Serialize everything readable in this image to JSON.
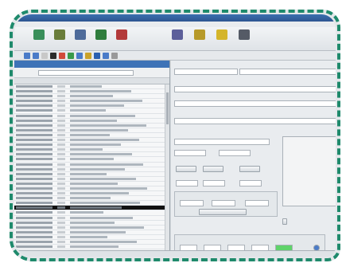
{
  "app": {
    "title": ""
  },
  "menu": [],
  "toolbar": [
    {
      "icon": "database-icon",
      "color": "#3a8f5a",
      "label": ""
    },
    {
      "icon": "book-icon",
      "color": "#6a7d3a",
      "label": ""
    },
    {
      "icon": "bird-icon",
      "color": "#4e6b9a",
      "label": ""
    },
    {
      "icon": "leaf-icon",
      "color": "#2f7d3d",
      "label": ""
    },
    {
      "icon": "heart-icon",
      "color": "#b33a3a",
      "label": ""
    },
    {
      "icon": "building-icon",
      "color": "#5c5f9a",
      "label": ""
    },
    {
      "icon": "house-icon",
      "color": "#b79a2a",
      "label": ""
    },
    {
      "icon": "lightbulb-icon",
      "color": "#d4b52a",
      "label": ""
    },
    {
      "icon": "person-icon",
      "color": "#555b66",
      "label": ""
    }
  ],
  "small_toolbar": [
    "#4a7bc8",
    "#4a7bc8",
    "#c8c8c8",
    "#2b2b2b",
    "#d14a3a",
    "#3a9a4a",
    "#4a7bc8",
    "#caa22a",
    "#2a5fb0",
    "#4a7bc8",
    "#999999"
  ],
  "list": {
    "header": "",
    "rows": 34,
    "selected_index": 25
  },
  "detail": {
    "field1_value": "",
    "field2_value": "",
    "field3_value": "",
    "notes_text": "",
    "checkbox_label": ""
  },
  "status": {
    "left": "",
    "right": ""
  }
}
